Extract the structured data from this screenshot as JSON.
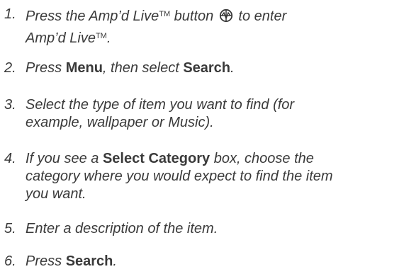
{
  "steps": [
    {
      "number": "1.",
      "t1": "Press the Amp’d Live",
      "tm1": "TM",
      "t2": " button ",
      "icon": "ampd-live-button-icon",
      "t3": " to enter",
      "t4": "Amp’d Live",
      "tm2": "TM",
      "t5": "."
    },
    {
      "number": "2.",
      "t1": "Press ",
      "b1": "Menu",
      "t2": ", then select ",
      "b2": "Search",
      "t3": "."
    },
    {
      "number": "3.",
      "line1": "Select the type of item you want to find (for",
      "line2": "example, wallpaper or Music)."
    },
    {
      "number": "4.",
      "t1": "If you see a ",
      "b1": "Select Category",
      "t2": " box, choose the",
      "line2": "category where you would expect to find the item",
      "line3": "you want."
    },
    {
      "number": "5.",
      "line1": "Enter a description of the item."
    },
    {
      "number": "6.",
      "t1": "Press ",
      "b1": "Search",
      "t2": "."
    }
  ]
}
